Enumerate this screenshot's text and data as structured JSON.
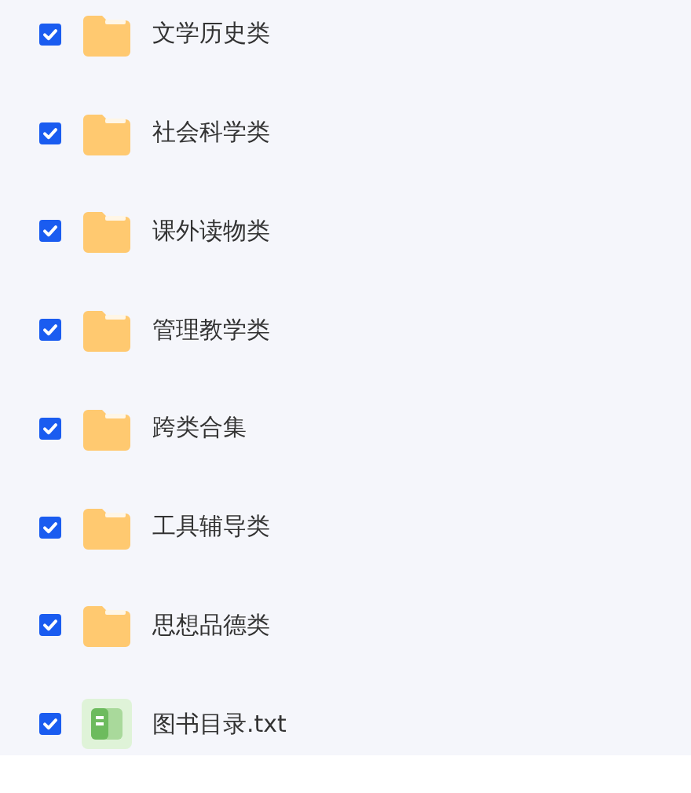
{
  "files": [
    {
      "kind": "folder",
      "name": "文学历史类",
      "checked": true
    },
    {
      "kind": "folder",
      "name": "社会科学类",
      "checked": true
    },
    {
      "kind": "folder",
      "name": "课外读物类",
      "checked": true
    },
    {
      "kind": "folder",
      "name": "管理教学类",
      "checked": true
    },
    {
      "kind": "folder",
      "name": "跨类合集",
      "checked": true
    },
    {
      "kind": "folder",
      "name": "工具辅导类",
      "checked": true
    },
    {
      "kind": "folder",
      "name": "思想品德类",
      "checked": true
    },
    {
      "kind": "text",
      "name": "图书目录.txt",
      "checked": true
    }
  ]
}
